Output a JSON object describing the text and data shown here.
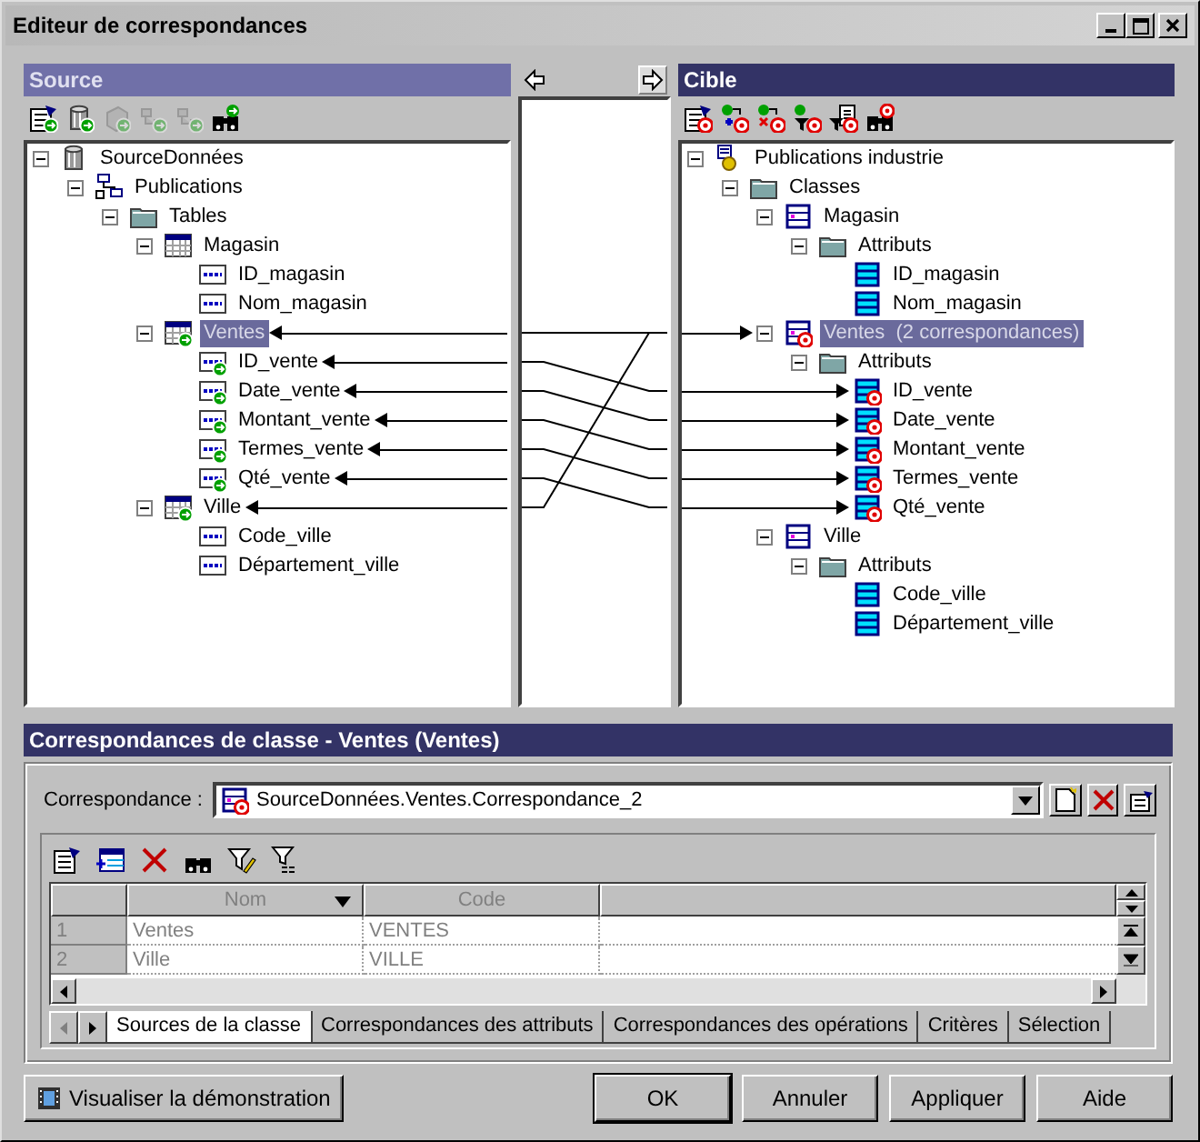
{
  "window": {
    "title": "Editeur de correspondances"
  },
  "source": {
    "title": "Source",
    "active": false,
    "toolbar": [
      {
        "kind": "properties",
        "disabled": false
      },
      {
        "kind": "database",
        "disabled": false
      },
      {
        "kind": "cube",
        "disabled": true
      },
      {
        "kind": "tree",
        "disabled": true
      },
      {
        "kind": "tree",
        "disabled": true
      },
      {
        "kind": "find",
        "disabled": false
      }
    ],
    "tree": [
      {
        "label": "SourceDonnées",
        "kind": "database",
        "expanded": true,
        "selected": false,
        "mapped": false,
        "children": [
          {
            "label": "Publications",
            "kind": "package",
            "expanded": true,
            "selected": false,
            "mapped": false,
            "children": [
              {
                "label": "Tables",
                "kind": "folder",
                "expanded": true,
                "selected": false,
                "mapped": false,
                "children": [
                  {
                    "label": "Magasin",
                    "kind": "table",
                    "expanded": true,
                    "selected": false,
                    "mapped": false,
                    "children": [
                      {
                        "label": "ID_magasin",
                        "kind": "column",
                        "selected": false,
                        "mapped": false
                      },
                      {
                        "label": "Nom_magasin",
                        "kind": "column",
                        "selected": false,
                        "mapped": false
                      }
                    ]
                  },
                  {
                    "label": "Ventes",
                    "kind": "table",
                    "expanded": true,
                    "selected": true,
                    "mapped": true,
                    "children": [
                      {
                        "label": "ID_vente",
                        "kind": "column",
                        "selected": false,
                        "mapped": true
                      },
                      {
                        "label": "Date_vente",
                        "kind": "column",
                        "selected": false,
                        "mapped": true
                      },
                      {
                        "label": "Montant_vente",
                        "kind": "column",
                        "selected": false,
                        "mapped": true
                      },
                      {
                        "label": "Termes_vente",
                        "kind": "column",
                        "selected": false,
                        "mapped": true
                      },
                      {
                        "label": "Qté_vente",
                        "kind": "column",
                        "selected": false,
                        "mapped": true
                      }
                    ]
                  },
                  {
                    "label": "Ville",
                    "kind": "table",
                    "expanded": true,
                    "selected": false,
                    "mapped": true,
                    "children": [
                      {
                        "label": "Code_ville",
                        "kind": "column",
                        "selected": false,
                        "mapped": false
                      },
                      {
                        "label": "Département_ville",
                        "kind": "column",
                        "selected": false,
                        "mapped": false
                      }
                    ]
                  }
                ]
              }
            ]
          }
        ]
      }
    ]
  },
  "target": {
    "title": "Cible",
    "active": true,
    "toolbar": [
      {
        "kind": "properties",
        "disabled": false
      },
      {
        "kind": "add",
        "disabled": false
      },
      {
        "kind": "remove",
        "disabled": false
      },
      {
        "kind": "filter",
        "disabled": false
      },
      {
        "kind": "list",
        "disabled": false
      },
      {
        "kind": "find",
        "disabled": false
      }
    ],
    "tree": [
      {
        "label": "Publications industrie",
        "kind": "diagram",
        "expanded": true,
        "selected": false,
        "mapped": false,
        "children": [
          {
            "label": "Classes",
            "kind": "folder",
            "expanded": true,
            "selected": false,
            "mapped": false,
            "children": [
              {
                "label": "Magasin",
                "kind": "class",
                "expanded": true,
                "selected": false,
                "mapped": false,
                "children": [
                  {
                    "label": "Attributs",
                    "kind": "folder",
                    "expanded": true,
                    "selected": false,
                    "mapped": false,
                    "children": [
                      {
                        "label": "ID_magasin",
                        "kind": "attribute",
                        "selected": false,
                        "mapped": false
                      },
                      {
                        "label": "Nom_magasin",
                        "kind": "attribute",
                        "selected": false,
                        "mapped": false
                      }
                    ]
                  }
                ]
              },
              {
                "label": "Ventes  (2 correspondances)",
                "kind": "class",
                "expanded": true,
                "selected": true,
                "mapped": true,
                "children": [
                  {
                    "label": "Attributs",
                    "kind": "folder",
                    "expanded": true,
                    "selected": false,
                    "mapped": false,
                    "children": [
                      {
                        "label": "ID_vente",
                        "kind": "attribute",
                        "selected": false,
                        "mapped": true
                      },
                      {
                        "label": "Date_vente",
                        "kind": "attribute",
                        "selected": false,
                        "mapped": true
                      },
                      {
                        "label": "Montant_vente",
                        "kind": "attribute",
                        "selected": false,
                        "mapped": true
                      },
                      {
                        "label": "Termes_vente",
                        "kind": "attribute",
                        "selected": false,
                        "mapped": true
                      },
                      {
                        "label": "Qté_vente",
                        "kind": "attribute",
                        "selected": false,
                        "mapped": true
                      }
                    ]
                  }
                ]
              },
              {
                "label": "Ville",
                "kind": "class",
                "expanded": true,
                "selected": false,
                "mapped": false,
                "children": [
                  {
                    "label": "Attributs",
                    "kind": "folder",
                    "expanded": true,
                    "selected": false,
                    "mapped": false,
                    "children": [
                      {
                        "label": "Code_ville",
                        "kind": "attribute",
                        "selected": false,
                        "mapped": false
                      },
                      {
                        "label": "Département_ville",
                        "kind": "attribute",
                        "selected": false,
                        "mapped": false
                      }
                    ]
                  }
                ]
              }
            ]
          }
        ]
      }
    ]
  },
  "class_mapping": {
    "title": "Correspondances de classe - Ventes (Ventes)",
    "mapping_label": "Correspondance :",
    "mapping_value": "SourceDonnées.Ventes.Correspondance_2",
    "toolbar": [
      {
        "kind": "properties"
      },
      {
        "kind": "addrows"
      },
      {
        "kind": "delete"
      },
      {
        "kind": "find"
      },
      {
        "kind": "filteredit"
      },
      {
        "kind": "filterclear"
      }
    ],
    "grid": {
      "columns": [
        {
          "label": "Nom",
          "sorted": true
        },
        {
          "label": "Code",
          "sorted": false
        }
      ],
      "rows": [
        {
          "number": "1",
          "cells": [
            "Ventes",
            "VENTES"
          ]
        },
        {
          "number": "2",
          "cells": [
            "Ville",
            "VILLE"
          ]
        }
      ]
    },
    "tabs": [
      {
        "label": "Sources de la classe",
        "selected": true
      },
      {
        "label": "Correspondances des attributs",
        "selected": false
      },
      {
        "label": "Correspondances des opérations",
        "selected": false
      },
      {
        "label": "Critères",
        "selected": false
      },
      {
        "label": "Sélection",
        "selected": false
      }
    ]
  },
  "demo_button": "Visualiser la démonstration",
  "buttons": [
    {
      "label": "OK",
      "default": true
    },
    {
      "label": "Annuler",
      "default": false
    },
    {
      "label": "Appliquer",
      "default": false
    },
    {
      "label": "Aide",
      "default": false
    }
  ]
}
